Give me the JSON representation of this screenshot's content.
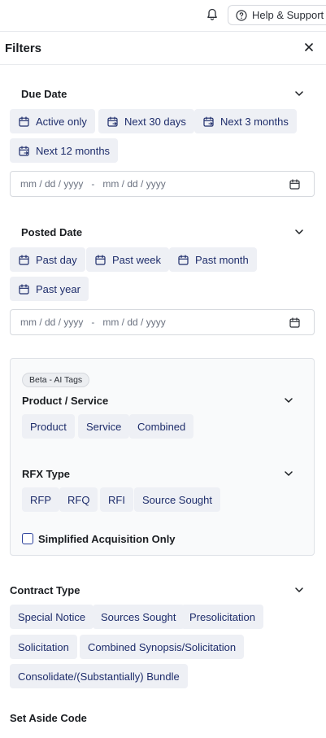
{
  "header": {
    "help_label": "Help & Support"
  },
  "panel": {
    "title": "Filters"
  },
  "due_date": {
    "title": "Due Date",
    "chips": [
      "Active only",
      "Next 30 days",
      "Next 3 months",
      "Next 12 months"
    ],
    "range": {
      "start": "mm / dd / yyyy",
      "separator": "-",
      "end": "mm / dd / yyyy"
    }
  },
  "posted_date": {
    "title": "Posted Date",
    "chips": [
      "Past day",
      "Past week",
      "Past month",
      "Past year"
    ],
    "range": {
      "start": "mm / dd / yyyy",
      "separator": "-",
      "end": "mm / dd / yyyy"
    }
  },
  "ai_tags": {
    "badge": "Beta - AI Tags",
    "product_service": {
      "title": "Product / Service",
      "chips": [
        "Product",
        "Service",
        "Combined"
      ]
    },
    "rfx_type": {
      "title": "RFX Type",
      "chips": [
        "RFP",
        "RFQ",
        "RFI",
        "Source Sought"
      ]
    },
    "simplified_label": "Simplified Acquisition Only",
    "simplified_checked": false
  },
  "contract_type": {
    "title": "Contract Type",
    "chips": [
      "Special Notice",
      "Sources Sought",
      "Presolicitation",
      "Solicitation",
      "Combined Synopsis/Solicitation",
      "Consolidate/(Substantially) Bundle"
    ]
  },
  "set_aside": {
    "title": "Set Aside Code"
  },
  "icons": {
    "bell": "bell-icon",
    "help": "question-circle-icon",
    "close": "close-icon",
    "chevron": "chevron-down-icon",
    "calendar": "calendar-icon",
    "calendar_next": "calendar-arrow-icon"
  },
  "colors": {
    "chip_bg": "#eef0f5",
    "chip_text": "#1e2d6b",
    "border": "#d6d9de"
  }
}
